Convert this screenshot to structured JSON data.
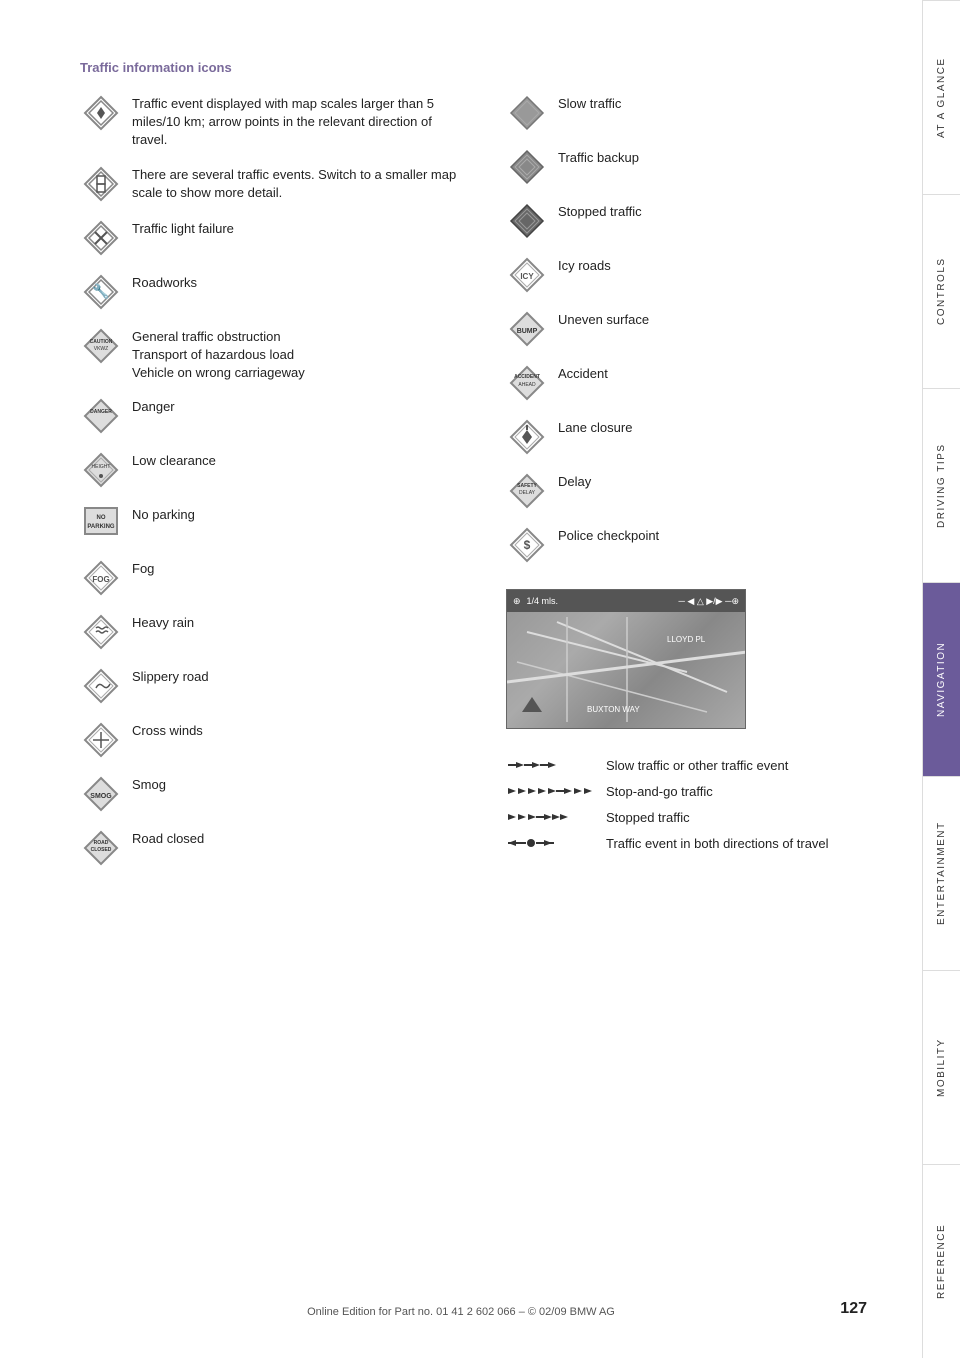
{
  "section_title": "Traffic information icons",
  "left_items": [
    {
      "id": "traffic-event",
      "icon_type": "diamond_arrow",
      "label": "Traffic event displayed with map scales larger than 5 miles/10 km; arrow points in the relevant direction of travel."
    },
    {
      "id": "several-events",
      "icon_type": "diamond_double",
      "label": "There are several traffic events. Switch to a smaller map scale to show more detail."
    },
    {
      "id": "traffic-light",
      "icon_type": "diamond_x",
      "label": "Traffic light failure"
    },
    {
      "id": "roadworks",
      "icon_type": "diamond_worker",
      "label": "Roadworks"
    },
    {
      "id": "obstruction",
      "icon_type": "diamond_caution",
      "label": "General traffic obstruction\nTransport of hazardous load\nVehicle on wrong carriageway"
    },
    {
      "id": "danger",
      "icon_type": "diamond_danger",
      "label": "Danger"
    },
    {
      "id": "low-clearance",
      "icon_type": "diamond_height",
      "label": "Low clearance"
    },
    {
      "id": "no-parking",
      "icon_type": "square_nopark",
      "label": "No parking"
    },
    {
      "id": "fog",
      "icon_type": "diamond_fog",
      "label": "Fog"
    },
    {
      "id": "heavy-rain",
      "icon_type": "diamond_rain",
      "label": "Heavy rain"
    },
    {
      "id": "slippery",
      "icon_type": "diamond_slip",
      "label": "Slippery road"
    },
    {
      "id": "crosswind",
      "icon_type": "diamond_wind",
      "label": "Cross winds"
    },
    {
      "id": "smog",
      "icon_type": "diamond_smog",
      "label": "Smog"
    },
    {
      "id": "road-closed",
      "icon_type": "diamond_closed",
      "label": "Road closed"
    }
  ],
  "right_items": [
    {
      "id": "slow-traffic",
      "icon_type": "diamond_slow",
      "label": "Slow traffic"
    },
    {
      "id": "traffic-backup",
      "icon_type": "diamond_backup",
      "label": "Traffic backup"
    },
    {
      "id": "stopped-traffic",
      "icon_type": "diamond_stopped",
      "label": "Stopped traffic"
    },
    {
      "id": "icy-roads",
      "icon_type": "diamond_icy",
      "label": "Icy roads"
    },
    {
      "id": "uneven-surface",
      "icon_type": "diamond_bump",
      "label": "Uneven surface"
    },
    {
      "id": "accident",
      "icon_type": "diamond_accident",
      "label": "Accident"
    },
    {
      "id": "lane-closure",
      "icon_type": "diamond_lane",
      "label": "Lane closure"
    },
    {
      "id": "delay",
      "icon_type": "diamond_delay",
      "label": "Delay"
    },
    {
      "id": "police",
      "icon_type": "diamond_police",
      "label": "Police checkpoint"
    }
  ],
  "legend_items": [
    {
      "id": "slow-or-other",
      "line_type": "slow",
      "label": "Slow traffic or other traffic event"
    },
    {
      "id": "stop-and-go",
      "line_type": "stopgo",
      "label": "Stop-and-go traffic"
    },
    {
      "id": "stopped",
      "line_type": "stopped",
      "label": "Stopped traffic"
    },
    {
      "id": "both-directions",
      "line_type": "both",
      "label": "Traffic event in both directions of travel"
    }
  ],
  "sidebar_sections": [
    {
      "id": "at-a-glance",
      "label": "AT A GLANCE",
      "active": false
    },
    {
      "id": "controls",
      "label": "CONTROLS",
      "active": false
    },
    {
      "id": "driving-tips",
      "label": "DRIVING TIPS",
      "active": false
    },
    {
      "id": "navigation",
      "label": "NAVIGATION",
      "active": true
    },
    {
      "id": "entertainment",
      "label": "ENTERTAINMENT",
      "active": false
    },
    {
      "id": "mobility",
      "label": "MOBILITY",
      "active": false
    },
    {
      "id": "reference",
      "label": "REFERENCE",
      "active": false
    }
  ],
  "page_number": "127",
  "footer": "Online Edition for Part no. 01 41 2 602 066 – © 02/09 BMW AG"
}
